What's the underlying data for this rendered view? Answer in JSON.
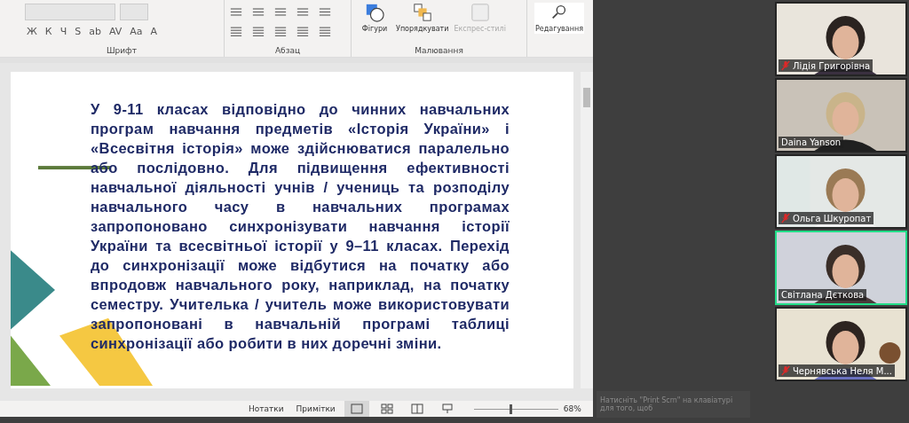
{
  "ribbon": {
    "font_controls": [
      "Ж",
      "К",
      "Ч",
      "S",
      "ab",
      "AV",
      "Aa",
      "A"
    ],
    "groups": [
      {
        "label": "Шрифт"
      },
      {
        "label": "Абзац"
      },
      {
        "label": "Малювання"
      }
    ],
    "drawing_buttons": [
      {
        "kind": "shapes",
        "label": "Фігури",
        "disabled": false
      },
      {
        "kind": "arrange",
        "label": "Упорядкувати",
        "disabled": false
      },
      {
        "kind": "styles",
        "label": "Експрес-стилі",
        "disabled": true
      }
    ],
    "editing": {
      "label": "Редагування"
    }
  },
  "slide": {
    "text": "У 9-11 класах відповідно до чинних навчальних програм навчання предметів «Історія України» і «Всесвітня історія» може здійснюватися паралельно або послідовно. Для підвищення ефективності навчальної діяльності учнів / учениць та розподілу навчального часу в навчальних програмах запропоновано синхронізувати навчання історії України та всесвітньої історії у 9–11 класах. Перехід до синхронізації може відбутися на початку або впродовж навчального року, наприклад, на початку семестру. Учителька / учитель може використовувати запропоновані в навчальній програмі таблиці синхронізації або робити в них доречні зміни."
  },
  "status_bar": {
    "notes": "Нотатки",
    "comments": "Примітки",
    "views": [
      {
        "kind": "normal",
        "selected": true
      },
      {
        "kind": "sorter",
        "selected": false
      },
      {
        "kind": "reading",
        "selected": false
      },
      {
        "kind": "show",
        "selected": false
      }
    ],
    "zoom": {
      "level": 0.42,
      "reading": "68%"
    }
  },
  "tooltip": "Натисніть \"Print Scrn\" на клавіатурі для того, щоб",
  "participants": [
    {
      "name": "Лідія Григорівна",
      "muted": true,
      "speaking": false
    },
    {
      "name": "Daina Yanson",
      "muted": false,
      "speaking": false
    },
    {
      "name": "Ольга Шкуропат",
      "muted": true,
      "speaking": false
    },
    {
      "name": "Світлана Дєткова",
      "muted": false,
      "speaking": true
    },
    {
      "name": "Чернявська Неля М...",
      "muted": true,
      "speaking": false
    }
  ]
}
